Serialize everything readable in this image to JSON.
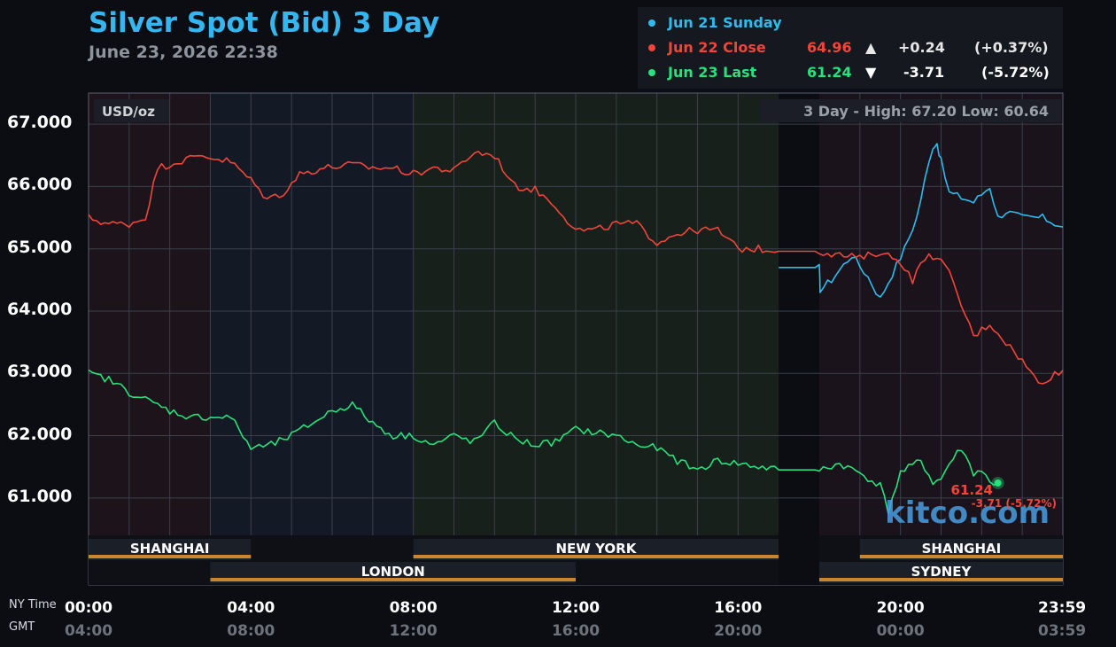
{
  "title": "Silver Spot (Bid) 3 Day",
  "subtitle": "June 23, 2026 22:38",
  "legend": [
    {
      "label": "Jun 21 Sunday",
      "color": "#2ebcf0",
      "value": "",
      "arrow": "",
      "change": "",
      "pct": ""
    },
    {
      "label": "Jun 22 Close",
      "color": "#f0463a",
      "value": "64.96",
      "arrow": "▲",
      "change": "+0.24",
      "pct": "(+0.37%)"
    },
    {
      "label": "Jun 23 Last",
      "color": "#26e27a",
      "value": "61.24",
      "arrow": "▼",
      "change": "-3.71",
      "pct": "(-5.72%)"
    }
  ],
  "chart_data": {
    "type": "line",
    "unit_label": "USD/oz",
    "stats_label": "3 Day - High: 67.20  Low: 60.64",
    "ylim": [
      60.4,
      67.5
    ],
    "yticks": [
      "67.000",
      "66.000",
      "65.000",
      "64.000",
      "63.000",
      "62.000",
      "61.000"
    ],
    "ytick_values": [
      67,
      66,
      65,
      64,
      63,
      62,
      61
    ],
    "xlim": [
      0,
      24
    ],
    "xlabel_row1": "NY Time",
    "xlabel_row2": "GMT",
    "xticks": [
      {
        "h": 0,
        "ny": "00:00",
        "gmt": "04:00"
      },
      {
        "h": 4,
        "ny": "04:00",
        "gmt": "08:00"
      },
      {
        "h": 8,
        "ny": "08:00",
        "gmt": "12:00"
      },
      {
        "h": 12,
        "ny": "12:00",
        "gmt": "16:00"
      },
      {
        "h": 16,
        "ny": "16:00",
        "gmt": "20:00"
      },
      {
        "h": 20,
        "ny": "20:00",
        "gmt": "00:00"
      },
      {
        "h": 23.98,
        "ny": "23:59",
        "gmt": "03:59"
      }
    ],
    "grid": true,
    "sessions_row1": [
      {
        "name": "SHANGHAI",
        "start": 0,
        "end": 4
      },
      {
        "name": "NEW YORK",
        "start": 8,
        "end": 17
      },
      {
        "name": "SHANGHAI",
        "start": 19,
        "end": 24
      }
    ],
    "sessions_row2": [
      {
        "name": "LONDON",
        "start": 3,
        "end": 12
      },
      {
        "name": "SYDNEY",
        "start": 18,
        "end": 24
      }
    ],
    "market_closed": {
      "start": 17,
      "end": 18
    },
    "series": [
      {
        "name": "Jun 21 Sunday",
        "color": "#2ebcf0",
        "x": [
          17,
          18,
          18.02,
          18.3,
          18.8,
          19.2,
          19.5,
          19.8,
          20.1,
          20.4,
          20.6,
          20.8,
          20.9,
          21.0,
          21.2,
          21.4,
          21.8,
          22.2,
          22.4,
          22.6,
          23.0,
          23.5,
          24
        ],
        "y": [
          64.7,
          64.7,
          64.35,
          64.5,
          64.9,
          64.55,
          64.2,
          64.6,
          65.0,
          65.5,
          66.1,
          66.65,
          66.7,
          66.4,
          65.9,
          65.85,
          65.75,
          66.0,
          65.5,
          65.6,
          65.5,
          65.5,
          65.35
        ]
      },
      {
        "name": "Jun 22 Close",
        "color": "#f0463a",
        "x": [
          0,
          0.5,
          1,
          1.4,
          1.7,
          2.2,
          2.8,
          3.5,
          4,
          4.4,
          4.8,
          5.2,
          5.8,
          6.5,
          7,
          7.5,
          8,
          8.5,
          9,
          9.5,
          10,
          10.5,
          11,
          11.5,
          12,
          12.5,
          13,
          13.5,
          14,
          14.5,
          15,
          15.5,
          16,
          16.5,
          17,
          18,
          18.5,
          19,
          19.5,
          20,
          20.3,
          20.6,
          20.9,
          21.2,
          21.5,
          21.8,
          22.2,
          22.6,
          23,
          23.4,
          24
        ],
        "y": [
          65.5,
          65.4,
          65.4,
          65.5,
          66.3,
          66.4,
          66.5,
          66.4,
          66.1,
          65.8,
          65.9,
          66.2,
          66.3,
          66.35,
          66.3,
          66.3,
          66.2,
          66.3,
          66.25,
          66.55,
          66.5,
          66.0,
          65.95,
          65.7,
          65.3,
          65.3,
          65.4,
          65.4,
          65.1,
          65.25,
          65.3,
          65.3,
          65.0,
          65.0,
          64.96,
          64.96,
          64.9,
          64.85,
          64.95,
          64.8,
          64.5,
          64.85,
          64.9,
          64.6,
          64.1,
          63.6,
          63.8,
          63.5,
          63.2,
          62.85,
          63.05
        ]
      },
      {
        "name": "Jun 23 Last",
        "color": "#26e27a",
        "x": [
          0,
          0.5,
          1,
          1.5,
          2,
          2.5,
          3,
          3.5,
          4,
          4.5,
          5,
          5.5,
          6,
          6.5,
          7,
          7.5,
          8,
          8.5,
          9,
          9.5,
          10,
          10.5,
          11,
          11.5,
          12,
          12.5,
          13,
          13.5,
          14,
          14.5,
          15,
          15.5,
          16,
          16.5,
          17,
          18,
          18.5,
          19,
          19.5,
          19.7,
          20,
          20.5,
          20.8,
          21,
          21.2,
          21.5,
          21.8,
          22,
          22.2,
          22.4
        ],
        "y": [
          63.0,
          62.9,
          62.7,
          62.55,
          62.4,
          62.3,
          62.3,
          62.3,
          61.8,
          61.85,
          62.0,
          62.2,
          62.4,
          62.5,
          62.2,
          62.0,
          62.0,
          61.85,
          62.0,
          61.9,
          62.2,
          61.95,
          61.85,
          61.9,
          62.1,
          62.05,
          62.0,
          61.85,
          61.8,
          61.6,
          61.45,
          61.6,
          61.55,
          61.5,
          61.45,
          61.45,
          61.55,
          61.4,
          61.2,
          60.8,
          61.4,
          61.6,
          61.25,
          61.3,
          61.55,
          61.8,
          61.4,
          61.45,
          61.24,
          61.24
        ]
      }
    ],
    "last_point": {
      "x": 22.4,
      "y": 61.24
    },
    "last_label_value": "61.24",
    "last_label_change": "-3.71 (-5.72%)",
    "watermark": "kitco.com"
  }
}
